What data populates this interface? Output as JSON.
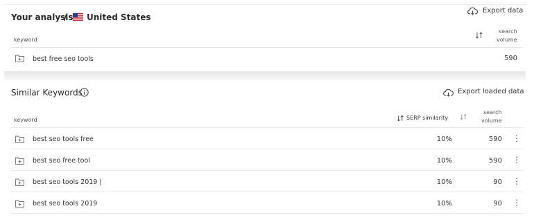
{
  "top": {
    "title": "Your analysis",
    "separator": "/",
    "country": "United States",
    "export_label": "Export data",
    "col_keyword": "keyword",
    "col_volume_line1": "search",
    "col_volume_line2": "volume",
    "row": {
      "keyword": "best free seo tools",
      "volume": "590"
    }
  },
  "similar": {
    "title": "Similar Keywords",
    "export_label": "Export loaded data",
    "col_keyword": "keyword",
    "col_serp": "SERP similarity",
    "col_volume_line1": "search",
    "col_volume_line2": "volume",
    "rows": [
      {
        "keyword": "best seo tools free",
        "similarity": "10%",
        "volume": "590"
      },
      {
        "keyword": "best seo free tool",
        "similarity": "10%",
        "volume": "590"
      },
      {
        "keyword": "best seo tools 2019 |",
        "similarity": "10%",
        "volume": "90"
      },
      {
        "keyword": "best seo tools 2019",
        "similarity": "10%",
        "volume": "90"
      }
    ]
  },
  "icons": [
    "cloud-download-icon",
    "info-icon",
    "folder-add-icon",
    "sort-icon",
    "more-vertical-icon",
    "us-flag-icon"
  ]
}
